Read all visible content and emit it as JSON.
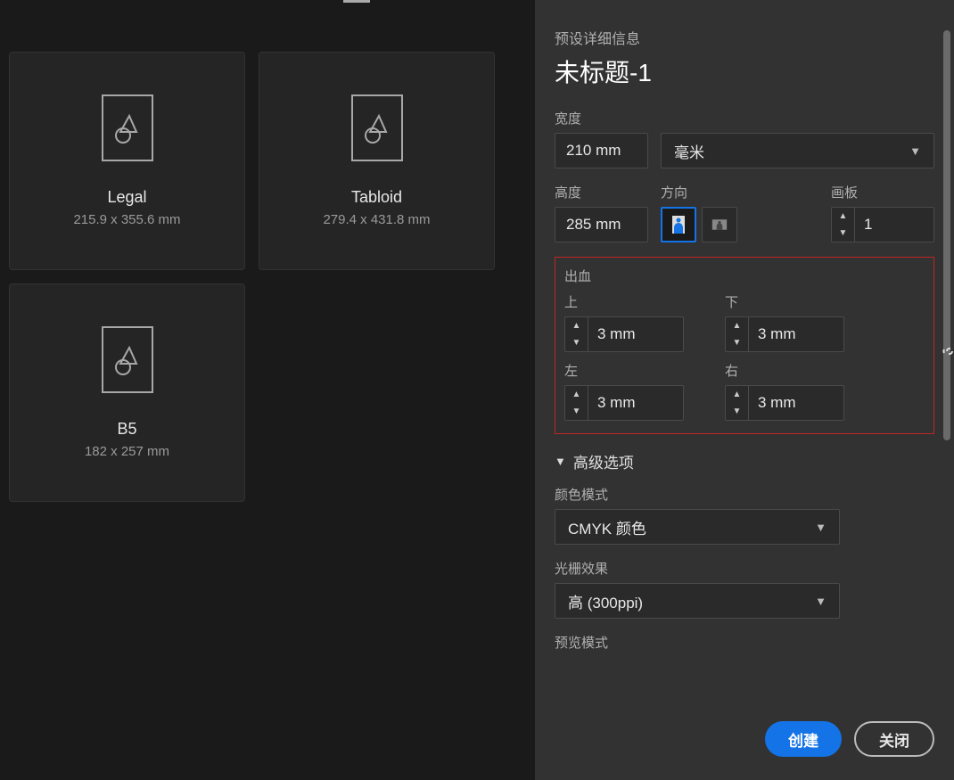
{
  "panel": {
    "details_label": "预设详细信息",
    "doc_title": "未标题-1",
    "width_label": "宽度",
    "width_value": "210 mm",
    "unit_selected": "毫米",
    "height_label": "高度",
    "height_value": "285 mm",
    "orient_label": "方向",
    "artboard_label": "画板",
    "artboard_value": "1",
    "bleed": {
      "section_label": "出血",
      "top_label": "上",
      "bottom_label": "下",
      "left_label": "左",
      "right_label": "右",
      "top": "3 mm",
      "bottom": "3 mm",
      "left": "3 mm",
      "right": "3 mm"
    },
    "advanced_label": "高级选项",
    "color_mode_label": "颜色模式",
    "color_mode_selected": "CMYK 颜色",
    "raster_label": "光栅效果",
    "raster_selected": "高 (300ppi)",
    "preview_label": "预览模式"
  },
  "presets": [
    {
      "name": "Legal",
      "dim": "215.9 x 355.6 mm"
    },
    {
      "name": "Tabloid",
      "dim": "279.4 x 431.8 mm"
    },
    {
      "name": "B5",
      "dim": "182 x 257 mm"
    }
  ],
  "footer": {
    "create": "创建",
    "close": "关闭"
  }
}
